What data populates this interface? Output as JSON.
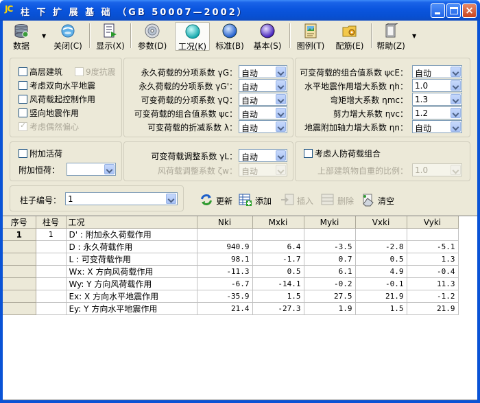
{
  "window": {
    "logo": "JC",
    "title": "柱 下 扩 展 基 础 （GB 50007—2002）"
  },
  "toolbar": {
    "items": [
      {
        "label": "数据",
        "icon": "database-icon"
      },
      {
        "label": "关闭(C)",
        "icon": "close-globe-icon"
      },
      {
        "label": "显示(X)",
        "icon": "display-icon"
      },
      {
        "label": "参数(D)",
        "icon": "disc-icon"
      },
      {
        "label": "工况(K)",
        "icon": "cyan-sphere-icon"
      },
      {
        "label": "标准(B)",
        "icon": "blue-sphere-icon"
      },
      {
        "label": "基本(S)",
        "icon": "purple-sphere-icon"
      },
      {
        "label": "图例(T)",
        "icon": "legend-icon"
      },
      {
        "label": "配筋(E)",
        "icon": "folder-gear-icon"
      },
      {
        "label": "帮助(Z)",
        "icon": "help-icon"
      }
    ]
  },
  "options": {
    "high_rise": "高层建筑",
    "nine_degree": "9度抗震",
    "bidirectional_seismic": "考虑双向水平地震",
    "wind_control": "风荷载起控制作用",
    "vertical_seismic": "竖向地震作用",
    "accidental_eccentricity": "考虑偶然偏心"
  },
  "coefficients_left": [
    {
      "label": "永久荷载的分项系数 γG：",
      "value": "自动"
    },
    {
      "label": "永久荷载的分项系数 γG'：",
      "value": "自动"
    },
    {
      "label": "可变荷载的分项系数 γQ：",
      "value": "自动"
    },
    {
      "label": "可变荷载的组合值系数 ψc：",
      "value": "自动"
    },
    {
      "label": "可变荷载的折减系数 λ：",
      "value": "自动"
    }
  ],
  "coefficients_right": [
    {
      "label": "可变荷载的组合值系数 ψcE：",
      "value": "自动"
    },
    {
      "label": "水平地震作用增大系数 ηh：",
      "value": "1.0"
    },
    {
      "label": "弯矩增大系数 ηmc：",
      "value": "1.3"
    },
    {
      "label": "剪力增大系数 ηvc：",
      "value": "1.2"
    },
    {
      "label": "地震附加轴力增大系数 ηn：",
      "value": "自动"
    }
  ],
  "additional": {
    "live_load_label": "附加活荷",
    "dead_load_label": "附加恒荷：",
    "dead_load_value": ""
  },
  "adjust": {
    "live_label": "可变荷载调整系数 γL：",
    "live_value": "自动",
    "wind_label": "风荷载调整系数 ζw：",
    "wind_value": "自动"
  },
  "civil_defense": {
    "label": "考虑人防荷载组合",
    "ratio_label": "上部建筑物自重的比例：",
    "ratio_value": "1.0"
  },
  "column": {
    "label": "柱子编号：",
    "value": "1"
  },
  "actions": {
    "update": "更新",
    "add": "添加",
    "insert": "插入",
    "delete": "删除",
    "clear": "清空"
  },
  "table": {
    "headers": [
      "序号",
      "柱号",
      "工况",
      "Nki",
      "Mxki",
      "Myki",
      "Vxki",
      "Vyki"
    ],
    "rows": [
      {
        "seq": "1",
        "col": "1",
        "case": "D' :  附加永久荷载作用",
        "n": "",
        "mx": "",
        "my": "",
        "vx": "",
        "vy": ""
      },
      {
        "seq": "",
        "col": "",
        "case": "D :  永久荷载作用",
        "n": "940.9",
        "mx": "6.4",
        "my": "-3.5",
        "vx": "-2.8",
        "vy": "-5.1"
      },
      {
        "seq": "",
        "col": "",
        "case": "L :  可变荷载作用",
        "n": "98.1",
        "mx": "-1.7",
        "my": "0.7",
        "vx": "0.5",
        "vy": "1.3"
      },
      {
        "seq": "",
        "col": "",
        "case": "Wx:  X 方向风荷载作用",
        "n": "-11.3",
        "mx": "0.5",
        "my": "6.1",
        "vx": "4.9",
        "vy": "-0.4"
      },
      {
        "seq": "",
        "col": "",
        "case": "Wy:  Y 方向风荷载作用",
        "n": "-6.7",
        "mx": "-14.1",
        "my": "-0.2",
        "vx": "-0.1",
        "vy": "11.3"
      },
      {
        "seq": "",
        "col": "",
        "case": "Ex:  X 方向水平地震作用",
        "n": "-35.9",
        "mx": "1.5",
        "my": "27.5",
        "vx": "21.9",
        "vy": "-1.2"
      },
      {
        "seq": "",
        "col": "",
        "case": "Ey:  Y 方向水平地震作用",
        "n": "21.4",
        "mx": "-27.3",
        "my": "1.9",
        "vx": "1.5",
        "vy": "21.9"
      }
    ]
  }
}
